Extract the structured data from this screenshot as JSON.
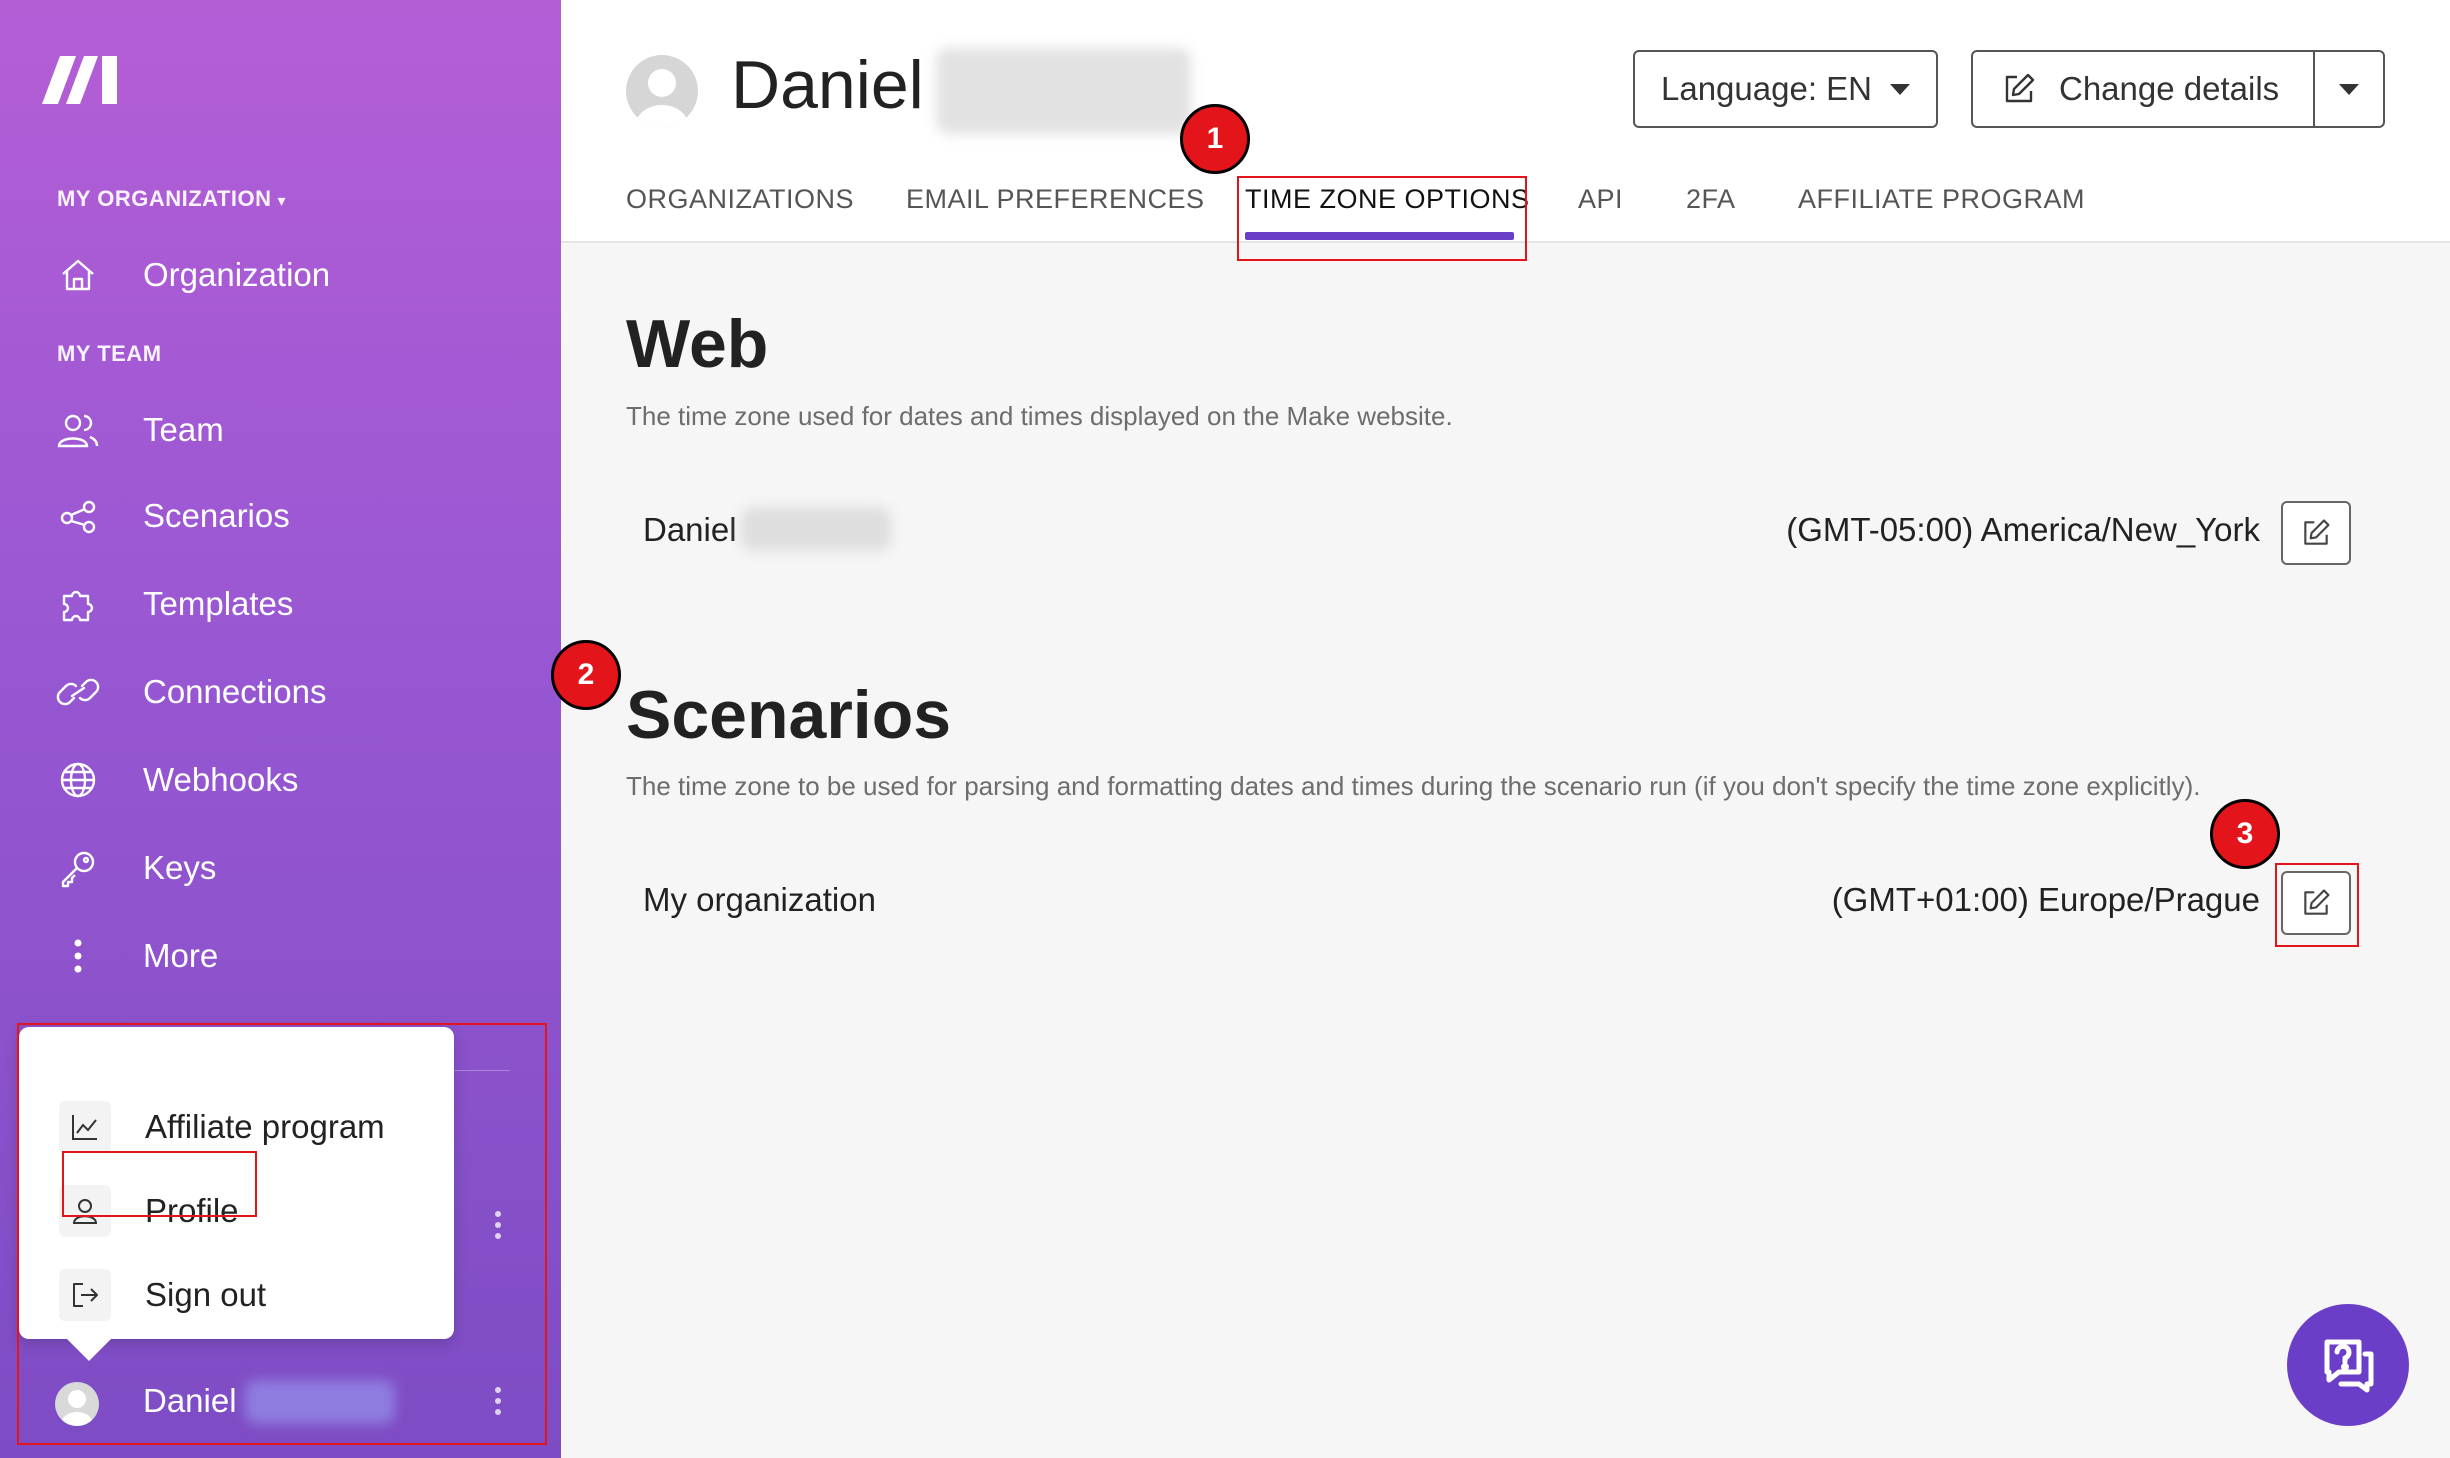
{
  "sidebar": {
    "org_label": "MY ORGANIZATION",
    "org_item": "Organization",
    "team_label": "MY TEAM",
    "items": [
      {
        "label": "Team",
        "icon": "users-icon"
      },
      {
        "label": "Scenarios",
        "icon": "share-nodes-icon"
      },
      {
        "label": "Templates",
        "icon": "puzzle-icon"
      },
      {
        "label": "Connections",
        "icon": "link-icon"
      },
      {
        "label": "Webhooks",
        "icon": "globe-icon"
      },
      {
        "label": "Keys",
        "icon": "key-icon"
      },
      {
        "label": "More",
        "icon": "more-vertical-icon"
      }
    ],
    "user_name": "Daniel"
  },
  "popup_menu": {
    "items": [
      {
        "label": "Affiliate program",
        "icon": "chart-line-icon"
      },
      {
        "label": "Profile",
        "icon": "user-icon"
      },
      {
        "label": "Sign out",
        "icon": "sign-out-icon"
      }
    ]
  },
  "header": {
    "profile_name": "Daniel",
    "language_button": "Language: EN",
    "change_details_button": "Change details"
  },
  "tabs": [
    {
      "label": "ORGANIZATIONS"
    },
    {
      "label": "EMAIL PREFERENCES"
    },
    {
      "label": "TIME ZONE OPTIONS",
      "active": true
    },
    {
      "label": "API"
    },
    {
      "label": "2FA"
    },
    {
      "label": "AFFILIATE PROGRAM"
    }
  ],
  "web_section": {
    "title": "Web",
    "description": "The time zone used for dates and times displayed on the Make website.",
    "row_label": "Daniel",
    "row_value": "(GMT-05:00) America/New_York"
  },
  "scenarios_section": {
    "title": "Scenarios",
    "description": "The time zone to be used for parsing and formatting dates and times during the scenario run (if you don't specify the time zone explicitly).",
    "row_label": "My organization",
    "row_value": "(GMT+01:00) Europe/Prague"
  },
  "annotations": {
    "badge_1": "1",
    "badge_2": "2",
    "badge_3": "3"
  },
  "colors": {
    "accent": "#6b3ec8",
    "highlight": "#e3141a",
    "sidebar_top": "#b45ed6",
    "sidebar_bottom": "#7d4cc4"
  }
}
